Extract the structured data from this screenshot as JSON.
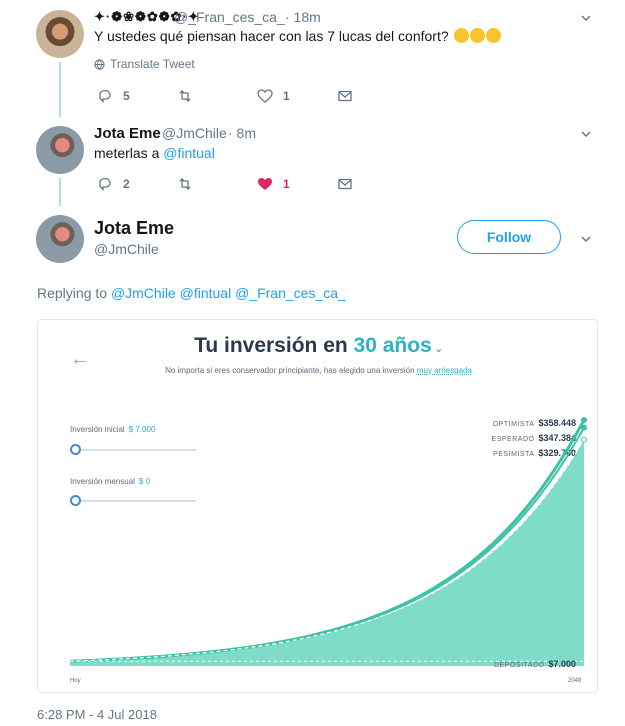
{
  "tweet1": {
    "name": "✦·❁❀❁✿❁✿·✦",
    "handle": "@_Fran_ces_ca_",
    "time": "· 18m",
    "text": "Y ustedes qué piensan hacer con las 7 lucas del confort?",
    "translate": "Translate Tweet",
    "replies": "5",
    "likes": "1"
  },
  "tweet2": {
    "name": "Jota Eme",
    "handle": "@JmChile",
    "time": "· 8m",
    "text_prefix": "meterlas a ",
    "mention": "@fintual",
    "replies": "2",
    "likes": "1"
  },
  "main": {
    "name": "Jota Eme",
    "handle": "@JmChile",
    "follow": "Follow",
    "replying_prefix": "Replying to",
    "replying_to": "@JmChile @fintual @_Fran_ces_ca_",
    "timestamp": "6:28 PM - 4 Jul 2018"
  },
  "card": {
    "title_prefix": "Tu inversión en ",
    "title_years": "30 años",
    "subtitle_prefix": "No importa si eres conservador principiante, has elegido una inversión ",
    "subtitle_risk": "muy arriesgada",
    "initial_label": "Inversión inicial",
    "initial_value": "$ 7.000",
    "monthly_label": "Inversión mensual",
    "monthly_value": "$ 0",
    "slider_levels": {
      "inicial": 0,
      "mensual": 0
    },
    "optimista_label": "OPTIMISTA",
    "optimista_value": "$358.448",
    "esperado_label": "ESPERADO",
    "esperado_value": "$347.384",
    "pesimista_label": "PESIMISTA",
    "pesimista_value": "$329.760",
    "depositado_label": "DEPOSITADO",
    "depositado_value": "$7.000",
    "x_start": "Hoy",
    "x_end": "2048",
    "colors": {
      "area": "#7fdcc8",
      "line": "#3ec2a6",
      "accent": "#2bb4c1"
    }
  },
  "chart_data": {
    "type": "area",
    "x": [
      "Hoy",
      "2048"
    ],
    "series": [
      {
        "name": "OPTIMISTA",
        "values": [
          7000,
          358448
        ]
      },
      {
        "name": "ESPERADO",
        "values": [
          7000,
          347384
        ]
      },
      {
        "name": "PESIMISTA",
        "values": [
          7000,
          329760
        ]
      },
      {
        "name": "DEPOSITADO",
        "values": [
          7000,
          7000
        ]
      }
    ],
    "title": "Tu inversión en 30 años",
    "xlabel": "",
    "ylabel": "",
    "grid": false
  }
}
